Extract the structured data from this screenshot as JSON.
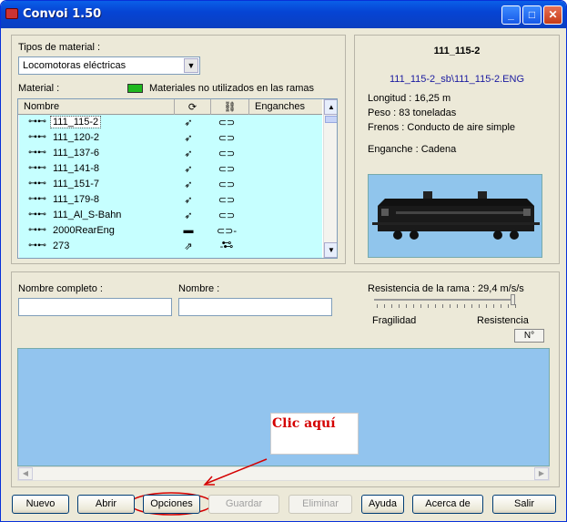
{
  "window": {
    "title": "Convoi 1.50"
  },
  "left": {
    "tipos_label": "Tipos de material :",
    "tipos_value": "Locomotoras eléctricas",
    "material_label": "Material :",
    "legend_text": "Materiales no utilizados en las ramas",
    "legend_color": "#1fb81f",
    "columns": {
      "nombre": "Nombre",
      "enganches": "Enganches"
    },
    "rows": [
      {
        "name": "111_115-2",
        "c1": "➶",
        "c2": "⊂⊃"
      },
      {
        "name": "111_120-2",
        "c1": "➶",
        "c2": "⊂⊃"
      },
      {
        "name": "111_137-6",
        "c1": "➶",
        "c2": "⊂⊃"
      },
      {
        "name": "111_141-8",
        "c1": "➶",
        "c2": "⊂⊃"
      },
      {
        "name": "111_151-7",
        "c1": "➶",
        "c2": "⊂⊃"
      },
      {
        "name": "111_179-8",
        "c1": "➶",
        "c2": "⊂⊃"
      },
      {
        "name": "111_Al_S-Bahn",
        "c1": "➶",
        "c2": "⊂⊃"
      },
      {
        "name": "2000RearEng",
        "c1": "▬",
        "c2": "⊂⊃-⊷"
      },
      {
        "name": "273",
        "c1": "⇗",
        "c2": "-⊷"
      }
    ]
  },
  "info": {
    "name": "111_115-2",
    "file": "111_115-2_sb\\111_115-2.ENG",
    "longitud": "Longitud :  16,25 m",
    "peso": "Peso :  83 toneladas",
    "frenos": "Frenos : Conducto de aire simple",
    "enganche": "Enganche : Cadena"
  },
  "middle": {
    "nombre_completo_label": "Nombre completo :",
    "nombre_label": "Nombre :",
    "resistencia_label": "Resistencia de la rama : 29,4 m/s/s",
    "fragilidad": "Fragilidad",
    "resistencia": "Resistencia",
    "n_button": "N°"
  },
  "annotation": {
    "text": "Clic aquí",
    "color": "#d40000"
  },
  "buttons": {
    "nuevo": "Nuevo",
    "abrir": "Abrir",
    "opciones": "Opciones",
    "guardar": "Guardar",
    "eliminar": "Eliminar",
    "ayuda": "Ayuda",
    "acerca": "Acerca de",
    "salir": "Salir"
  }
}
